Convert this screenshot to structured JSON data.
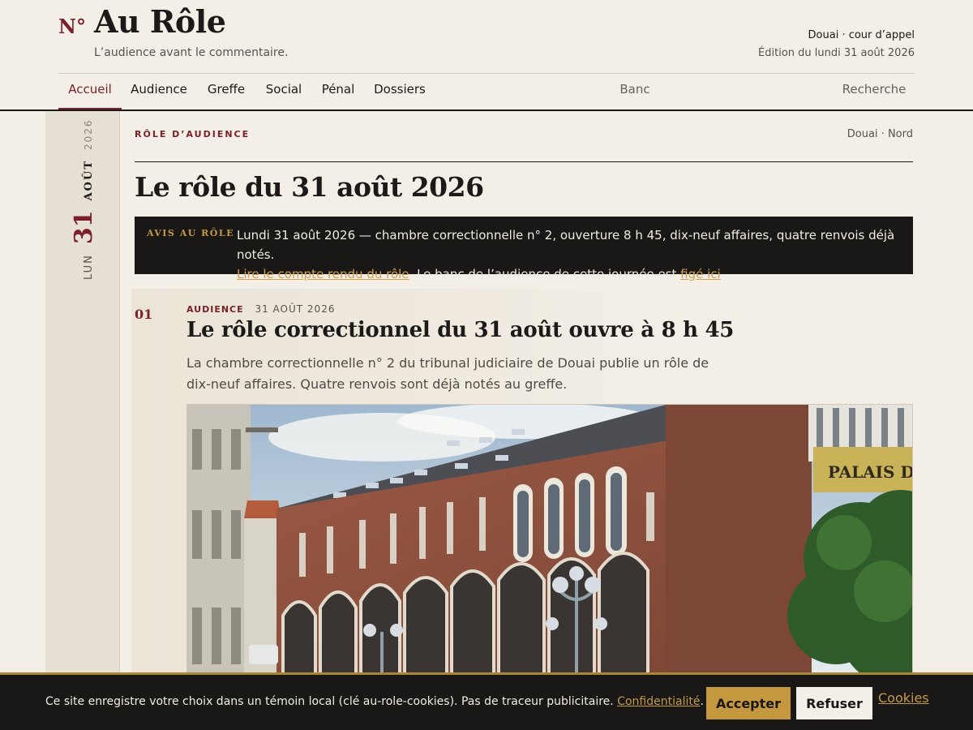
{
  "header": {
    "brand_mark": "N°",
    "brand_title": "Au Rôle",
    "tagline": "L’audience avant le commentaire.",
    "court": "Douai · cour d’appel",
    "edition": "Édition du lundi 31 août 2026"
  },
  "nav": {
    "items": [
      {
        "label": "Accueil",
        "active": true
      },
      {
        "label": "Audience"
      },
      {
        "label": "Greffe"
      },
      {
        "label": "Social"
      },
      {
        "label": "Pénal"
      },
      {
        "label": "Dossiers"
      }
    ],
    "bench": "Banc",
    "search": "Recherche"
  },
  "rail": {
    "weekday": "LUN",
    "day": "31",
    "month": "AOÛT",
    "year": "2026"
  },
  "main": {
    "kicker": "RÔLE D’AUDIENCE",
    "location": "Douai · Nord",
    "title": "Le rôle du 31 août 2026"
  },
  "notice": {
    "label": "AVIS AU RÔLE",
    "text": "Lundi 31 août 2026 — chambre correctionnelle n° 2, ouverture 8 h 45, dix-neuf affaires, quatre renvois déjà notés.",
    "link_report": "Lire le compte rendu du rôle",
    "text_middle": ". Le banc de l’audience de cette journée est ",
    "link_frozen": "figé ici",
    "text_end": "."
  },
  "article": {
    "number": "01",
    "section": "AUDIENCE",
    "date": "31 AOÛT 2026",
    "title": "Le rôle correctionnel du 31 août ouvre à 8 h 45",
    "lede": "La chambre correctionnelle n° 2 du tribunal judiciaire de Douai publie un rôle de dix-neuf affaires. Quatre renvois sont déjà notés au greffe.",
    "image_sign": "PALAIS DE J"
  },
  "cookie": {
    "text": "Ce site enregistre votre choix dans un témoin local (clé au-role-cookies). Pas de traceur publicitaire. ",
    "privacy_link": "Confidentialité",
    "text_end": ".",
    "accept": "Accepter",
    "refuse": "Refuser",
    "settings_link": "Cookies"
  },
  "colors": {
    "accent": "#7a1f2b",
    "gold": "#c5973f",
    "paper": "#f3efe7",
    "ink": "#1a1816"
  }
}
